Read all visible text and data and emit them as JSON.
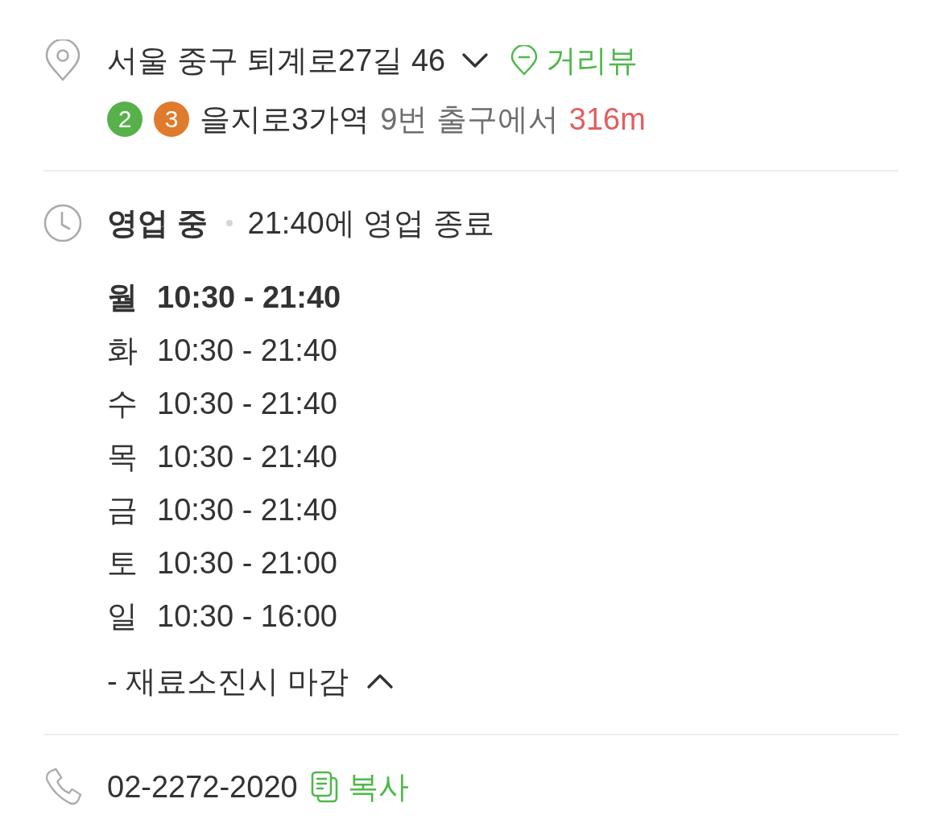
{
  "address": {
    "text": "서울 중구 퇴계로27길 46",
    "expanded": false,
    "street_view": "거리뷰"
  },
  "transit": {
    "lines": [
      {
        "label": "2",
        "color": "#58b04b"
      },
      {
        "label": "3",
        "color": "#e07a2c"
      }
    ],
    "station": "을지로3가역",
    "exit": "9번 출구에서",
    "distance": "316m"
  },
  "hours": {
    "status": "영업 중",
    "detail": "21:40에 영업 종료",
    "expanded": true,
    "days": [
      {
        "day": "월",
        "time": "10:30 - 21:40",
        "today": true
      },
      {
        "day": "화",
        "time": "10:30 - 21:40",
        "today": false
      },
      {
        "day": "수",
        "time": "10:30 - 21:40",
        "today": false
      },
      {
        "day": "목",
        "time": "10:30 - 21:40",
        "today": false
      },
      {
        "day": "금",
        "time": "10:30 - 21:40",
        "today": false
      },
      {
        "day": "토",
        "time": "10:30 - 21:00",
        "today": false
      },
      {
        "day": "일",
        "time": "10:30 - 16:00",
        "today": false
      }
    ],
    "note": "- 재료소진시 마감"
  },
  "phone": {
    "number": "02-2272-2020",
    "copy": "복사"
  }
}
